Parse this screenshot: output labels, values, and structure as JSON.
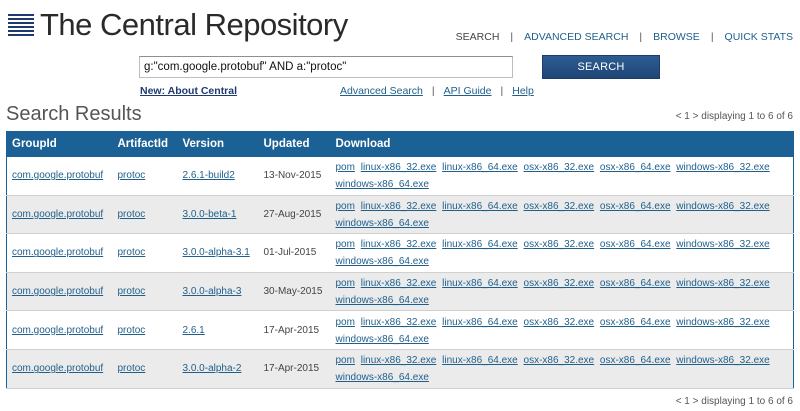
{
  "header": {
    "title": "The Central Repository",
    "nav": [
      {
        "label": "SEARCH"
      },
      {
        "label": "ADVANCED SEARCH"
      },
      {
        "label": "BROWSE"
      },
      {
        "label": "QUICK STATS"
      }
    ]
  },
  "search": {
    "value": "g:\"com.google.protobuf\" AND a:\"protoc\"",
    "button_label": "SEARCH"
  },
  "subnav": {
    "news_label": "New: About Central",
    "links": [
      "Advanced Search",
      "API Guide",
      "Help"
    ]
  },
  "results": {
    "title": "Search Results",
    "pager_top": "< 1 > displaying 1 to 6 of 6",
    "pager_bottom": "< 1 > displaying 1 to 6 of 6",
    "columns": [
      "GroupId",
      "ArtifactId",
      "Version",
      "Updated",
      "Download"
    ],
    "rows": [
      {
        "group": "com.google.protobuf",
        "artifact": "protoc",
        "version": "2.6.1-build2",
        "updated": "13-Nov-2015",
        "downloads": [
          "pom",
          "linux-x86_32.exe",
          "linux-x86_64.exe",
          "osx-x86_32.exe",
          "osx-x86_64.exe",
          "windows-x86_32.exe",
          "windows-x86_64.exe"
        ]
      },
      {
        "group": "com.google.protobuf",
        "artifact": "protoc",
        "version": "3.0.0-beta-1",
        "updated": "27-Aug-2015",
        "downloads": [
          "pom",
          "linux-x86_32.exe",
          "linux-x86_64.exe",
          "osx-x86_32.exe",
          "osx-x86_64.exe",
          "windows-x86_32.exe",
          "windows-x86_64.exe"
        ]
      },
      {
        "group": "com.google.protobuf",
        "artifact": "protoc",
        "version": "3.0.0-alpha-3.1",
        "updated": "01-Jul-2015",
        "downloads": [
          "pom",
          "linux-x86_32.exe",
          "linux-x86_64.exe",
          "osx-x86_32.exe",
          "osx-x86_64.exe",
          "windows-x86_32.exe",
          "windows-x86_64.exe"
        ]
      },
      {
        "group": "com.google.protobuf",
        "artifact": "protoc",
        "version": "3.0.0-alpha-3",
        "updated": "30-May-2015",
        "downloads": [
          "pom",
          "linux-x86_32.exe",
          "linux-x86_64.exe",
          "osx-x86_32.exe",
          "osx-x86_64.exe",
          "windows-x86_32.exe",
          "windows-x86_64.exe"
        ]
      },
      {
        "group": "com.google.protobuf",
        "artifact": "protoc",
        "version": "2.6.1",
        "updated": "17-Apr-2015",
        "downloads": [
          "pom",
          "linux-x86_32.exe",
          "linux-x86_64.exe",
          "osx-x86_32.exe",
          "osx-x86_64.exe",
          "windows-x86_32.exe",
          "windows-x86_64.exe"
        ]
      },
      {
        "group": "com.google.protobuf",
        "artifact": "protoc",
        "version": "3.0.0-alpha-2",
        "updated": "17-Apr-2015",
        "downloads": [
          "pom",
          "linux-x86_32.exe",
          "linux-x86_64.exe",
          "osx-x86_32.exe",
          "osx-x86_64.exe",
          "windows-x86_32.exe",
          "windows-x86_64.exe"
        ]
      }
    ]
  },
  "colors": {
    "header_blue": "#1c6195",
    "link": "#1f5f8b",
    "row_alt": "#ebebeb",
    "button": "#1f4576"
  }
}
